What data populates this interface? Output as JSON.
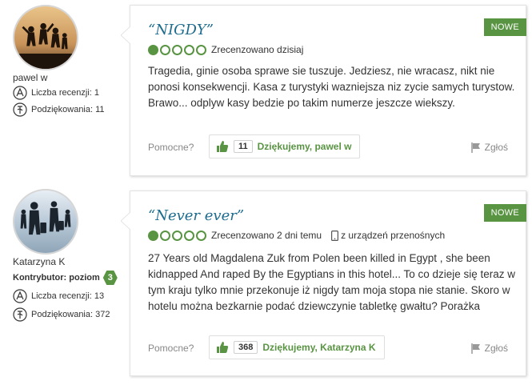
{
  "colors": {
    "accent": "#589442",
    "title": "#1e6c8e",
    "badge": "#589442"
  },
  "reviews": [
    {
      "user": {
        "name": "pawel w",
        "contributor_label": "",
        "level": ""
      },
      "stats": {
        "reviews_label": "Liczba recenzji: 1",
        "thanks_label": "Podziękowania: 11"
      },
      "title": "“NIGDY”",
      "badge": "NOWE",
      "rating_bubbles": 1,
      "reviewed": "Zrecenzowano dzisiaj",
      "device": "",
      "text": "Tragedia, ginie osoba sprawe sie tuszuje. Jedziesz, nie wracasz, nikt nie ponosi konsekwencji. Kasa z turystyki wazniejsza niz zycie samych turystow. Brawo... odplyw kasy bedzie po takim numerze jeszcze wiekszy.",
      "helpful_label": "Pomocne?",
      "thanks_count": "11",
      "thanks_button": "Dziękujemy, pawel w",
      "report_label": "Zgłoś",
      "icons": {
        "reviews": "review-count-icon",
        "thanks": "thanks-count-icon",
        "thumb": "thumbs-up-icon",
        "flag": "flag-icon"
      }
    },
    {
      "user": {
        "name": "Katarzyna K",
        "contributor_label": "Kontrybutor: poziom",
        "level": "3"
      },
      "stats": {
        "reviews_label": "Liczba recenzji: 13",
        "thanks_label": "Podziękowania: 372"
      },
      "title": "“Never ever”",
      "badge": "NOWE",
      "rating_bubbles": 1,
      "reviewed": "Zrecenzowano 2 dni temu",
      "device": "z urządzeń przenośnych",
      "text": "27 Years old Magdalena Zuk from Polen been killed in Egypt , she been kidnapped And raped By the Egyptians in this hotel... To co dzieje się teraz w tym kraju tylko mnie przekonuje iż nigdy tam moja stopa nie stanie. Skoro w hotelu można bezkarnie podać dziewczynie tabletkę gwałtu? Porażka",
      "helpful_label": "Pomocne?",
      "thanks_count": "368",
      "thanks_button": "Dziękujemy, Katarzyna K",
      "report_label": "Zgłoś",
      "icons": {
        "reviews": "review-count-icon",
        "thanks": "thanks-count-icon",
        "thumb": "thumbs-up-icon",
        "flag": "flag-icon",
        "device": "mobile-phone-icon"
      }
    }
  ]
}
